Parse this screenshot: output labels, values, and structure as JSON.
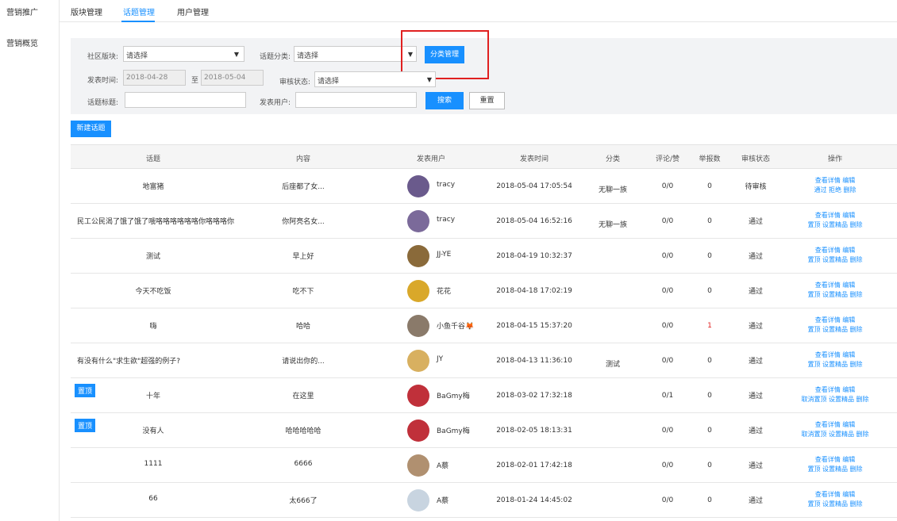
{
  "sidebar": {
    "brand": "营销推广",
    "items": [
      {
        "label": "营销概览"
      }
    ]
  },
  "topnav": {
    "tabs": [
      {
        "label": "版块管理"
      },
      {
        "label": "话题管理"
      },
      {
        "label": "用户管理"
      }
    ],
    "active": "话题管理"
  },
  "filters": {
    "community_label": "社区版块:",
    "community_value": "请选择",
    "category_label": "话题分类:",
    "category_value": "请选择",
    "category_manage_button": "分类管理",
    "date_label": "发表时间:",
    "date_from": "2018-04-28",
    "date_sep": "至",
    "date_to": "2018-05-04",
    "review_label": "审核状态:",
    "review_value": "请选择",
    "title_label": "话题标题:",
    "title_value": "",
    "user_label": "发表用户:",
    "user_value": "",
    "search_button": "搜索",
    "reset_button": "重置"
  },
  "new_topic_button": "新建话题",
  "table": {
    "columns": [
      "话题",
      "内容",
      "发表用户",
      "发表时间",
      "分类",
      "评论/赞",
      "举报数",
      "审核状态",
      "操作"
    ],
    "rows": [
      {
        "topic": "地富猪",
        "content": "后座都了女...",
        "user": "tracy",
        "time": "2018-05-04 17:05:54",
        "category": "无聊一族",
        "comments": "0/0",
        "reports": "0",
        "status": "待审核",
        "ops1": "查看详情 编辑",
        "ops2": "通过 拒绝 删除",
        "pinned": ""
      },
      {
        "topic": "民工公民渴了饿了饿了哦咯咯咯咯咯咯你咯咯咯你",
        "content": "你阿亮名女...",
        "user": "tracy",
        "time": "2018-05-04 16:52:16",
        "category": "无聊一族",
        "comments": "0/0",
        "reports": "0",
        "status": "通过",
        "ops1": "查看详情 编辑",
        "ops2": "置顶 设置精品 删除",
        "pinned": ""
      },
      {
        "topic": "测试",
        "content": "早上好",
        "user": "JJ-YE",
        "time": "2018-04-19 10:32:37",
        "category": "",
        "comments": "0/0",
        "reports": "0",
        "status": "通过",
        "ops1": "查看详情 编辑",
        "ops2": "置顶 设置精品 删除",
        "pinned": ""
      },
      {
        "topic": "今天不吃饭",
        "content": "吃不下",
        "user": "花花",
        "time": "2018-04-18 17:02:19",
        "category": "",
        "comments": "0/0",
        "reports": "0",
        "status": "通过",
        "ops1": "查看详情 编辑",
        "ops2": "置顶 设置精品 删除",
        "pinned": ""
      },
      {
        "topic": "嗨",
        "content": "哈哈",
        "user": "小鱼千谷🦊",
        "time": "2018-04-15 15:37:20",
        "category": "",
        "comments": "0/0",
        "reports": "1",
        "status": "通过",
        "ops1": "查看详情 编辑",
        "ops2": "置顶 设置精品 删除",
        "pinned": ""
      },
      {
        "topic": "有没有什么\"求生欲\"超强的例子?",
        "content": "请说出你的...",
        "user": "JY",
        "time": "2018-04-13 11:36:10",
        "category": "测试",
        "comments": "0/0",
        "reports": "0",
        "status": "通过",
        "ops1": "查看详情 编辑",
        "ops2": "置顶 设置精品 删除",
        "pinned": ""
      },
      {
        "topic": "十年",
        "content": "在这里",
        "user": "BaGmy梅",
        "time": "2018-03-02 17:32:18",
        "category": "",
        "comments": "0/1",
        "reports": "0",
        "status": "通过",
        "ops1": "查看详情 编辑",
        "ops2": "取消置顶 设置精品 删除",
        "pinned": "置顶"
      },
      {
        "topic": "没有人",
        "content": "哈哈哈哈哈",
        "user": "BaGmy梅",
        "time": "2018-02-05 18:13:31",
        "category": "",
        "comments": "0/0",
        "reports": "0",
        "status": "通过",
        "ops1": "查看详情 编辑",
        "ops2": "取消置顶 设置精品 删除",
        "pinned": "置顶"
      },
      {
        "topic": "1111",
        "content": "6666",
        "user": "A蔡",
        "time": "2018-02-01 17:42:18",
        "category": "",
        "comments": "0/0",
        "reports": "0",
        "status": "通过",
        "ops1": "查看详情 编辑",
        "ops2": "置顶 设置精品 删除",
        "pinned": ""
      },
      {
        "topic": "66",
        "content": "太666了",
        "user": "A蔡",
        "time": "2018-01-24 14:45:02",
        "category": "",
        "comments": "0/0",
        "reports": "0",
        "status": "通过",
        "ops1": "查看详情 编辑",
        "ops2": "置顶 设置精品 删除",
        "pinned": ""
      }
    ]
  },
  "avatar_colors": [
    "#6a5a8c",
    "#7b6a9a",
    "#8a6a3a",
    "#d9a82a",
    "#8a7a6a",
    "#d8b060",
    "#c0303a",
    "#c0303a",
    "#b09070",
    "#c8d4e0"
  ],
  "colors": {
    "accent": "#1890ff",
    "highlight_box": "#e02020"
  }
}
